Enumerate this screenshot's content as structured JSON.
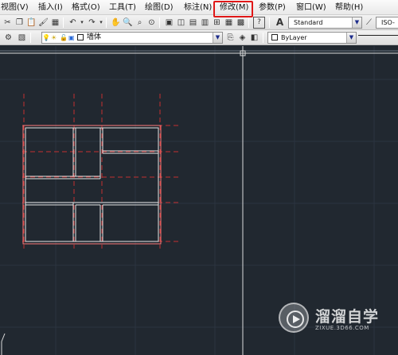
{
  "menubar": {
    "items": [
      {
        "label": "视图(V)"
      },
      {
        "label": "插入(I)"
      },
      {
        "label": "格式(O)"
      },
      {
        "label": "工具(T)"
      },
      {
        "label": "绘图(D)"
      },
      {
        "label": "标注(N)"
      },
      {
        "label": "修改(M)",
        "highlighted": true
      },
      {
        "label": "参数(P)"
      },
      {
        "label": "窗口(W)"
      },
      {
        "label": "帮助(H)"
      }
    ]
  },
  "toolbar_standard": {
    "text_style_value": "Standard",
    "dim_style_value": "ISO-"
  },
  "toolbar_layers": {
    "layer_name": "墙体",
    "color_value": "ByLayer"
  },
  "colors": {
    "highlight": "#e01818",
    "canvas_background": "#212830",
    "walls": "#e8e8e8",
    "axis_lines": "#c43030",
    "crosshair": "#dcdcdc"
  },
  "watermark": {
    "title": "溜溜自学",
    "url": "ZIXUE.3D66.COM"
  }
}
